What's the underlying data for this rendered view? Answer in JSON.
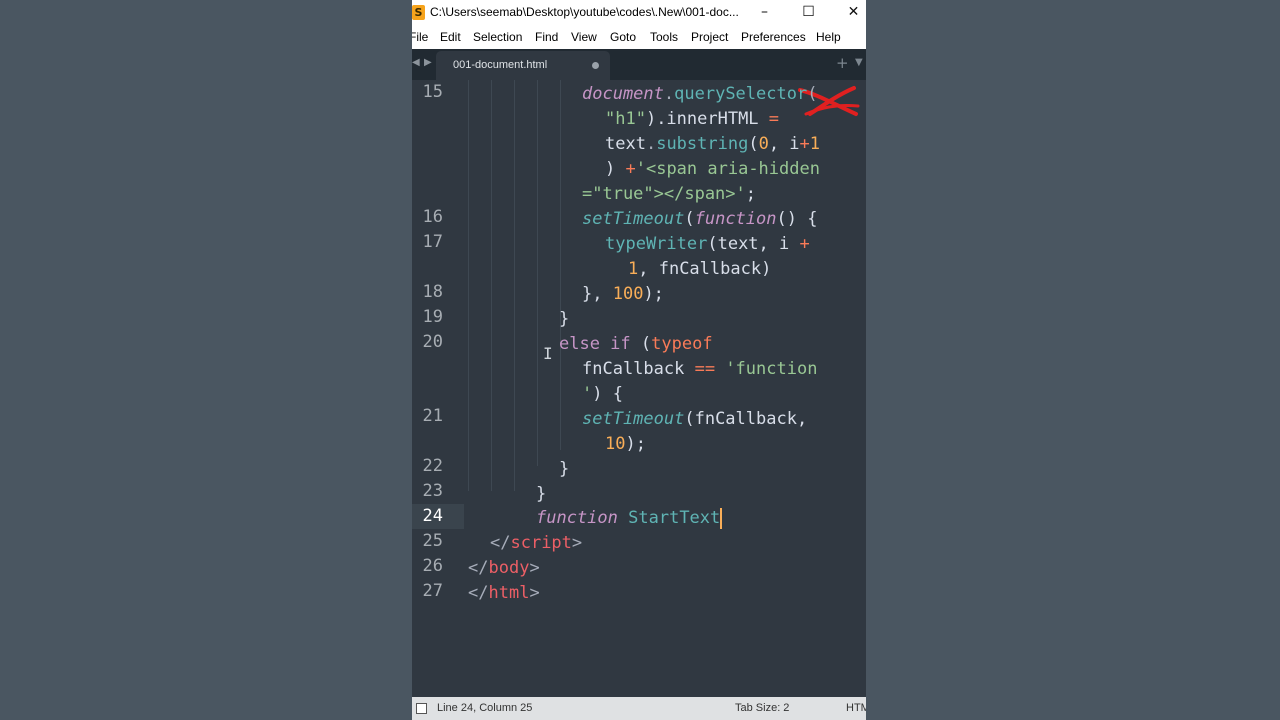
{
  "window": {
    "title": "C:\\Users\\seemab\\Desktop\\youtube\\codes\\.New\\001-doc...",
    "app_icon": "S",
    "controls": {
      "minimize": "–",
      "maximize": "☐",
      "close": "✕"
    }
  },
  "menu": [
    "File",
    "Edit",
    "Selection",
    "Find",
    "View",
    "Goto",
    "Tools",
    "Project",
    "Preferences",
    "Help"
  ],
  "tabbar": {
    "nav_left": "◀",
    "nav_right": "▶",
    "tab_label": "001-document.html",
    "plus": "+",
    "caret": "▼"
  },
  "gutter": [
    "15",
    "16",
    "17",
    "18",
    "19",
    "20",
    "21",
    "22",
    "23",
    "24",
    "25",
    "26",
    "27"
  ],
  "code": {
    "l15a_1": "document",
    "l15a_2": ".",
    "l15a_3": "querySelector",
    "l15a_4": "(",
    "l15b_1": "\"h1\"",
    "l15b_2": ").innerHTML ",
    "l15b_3": "=",
    "l15c_1": "text",
    "l15c_2": ".",
    "l15c_3": "substring",
    "l15c_4": "(",
    "l15c_5": "0",
    "l15c_6": ", i",
    "l15c_7": "+",
    "l15c_8": "1",
    "l15d_1": ") ",
    "l15d_2": "+",
    "l15d_3": "'<span aria-hidden",
    "l15e_1": "=\"true\"></span>'",
    "l15e_2": ";",
    "l16_1": "setTimeout",
    "l16_2": "(",
    "l16_3": "function",
    "l16_4": "() {",
    "l17a_1": "typeWriter",
    "l17a_2": "(text, i ",
    "l17a_3": "+",
    "l17b_1": "1",
    "l17b_2": ", fnCallback)",
    "l18_1": "}, ",
    "l18_2": "100",
    "l18_3": ");",
    "l19_1": "}",
    "l20a_1": "else if",
    "l20a_2": " (",
    "l20a_3": "typeof",
    "l20b_1": "fnCallback ",
    "l20b_2": "==",
    "l20b_3": " 'function",
    "l20c_1": "'",
    "l20c_2": ") {",
    "l21a_1": "setTimeout",
    "l21a_2": "(fnCallback,",
    "l21b_1": "10",
    "l21b_2": ");",
    "l22_1": "}",
    "l23_1": "}",
    "l24_1": "function",
    "l24_2": " ",
    "l24_3": "StartText",
    "l25_1": "</",
    "l25_2": "script",
    "l25_3": ">",
    "l26_1": "</",
    "l26_2": "body",
    "l26_3": ">",
    "l27_1": "</",
    "l27_2": "html",
    "l27_3": ">"
  },
  "status": {
    "position": "Line 24, Column 25",
    "tab_size": "Tab Size: 2",
    "syntax": "HTM"
  },
  "colors": {
    "editor_bg": "#303841",
    "keyword": "#c695c6",
    "function": "#5fb4b4",
    "operator": "#f97b58",
    "number": "#f9ae58",
    "string": "#99c794",
    "tag": "#ec5f66"
  }
}
